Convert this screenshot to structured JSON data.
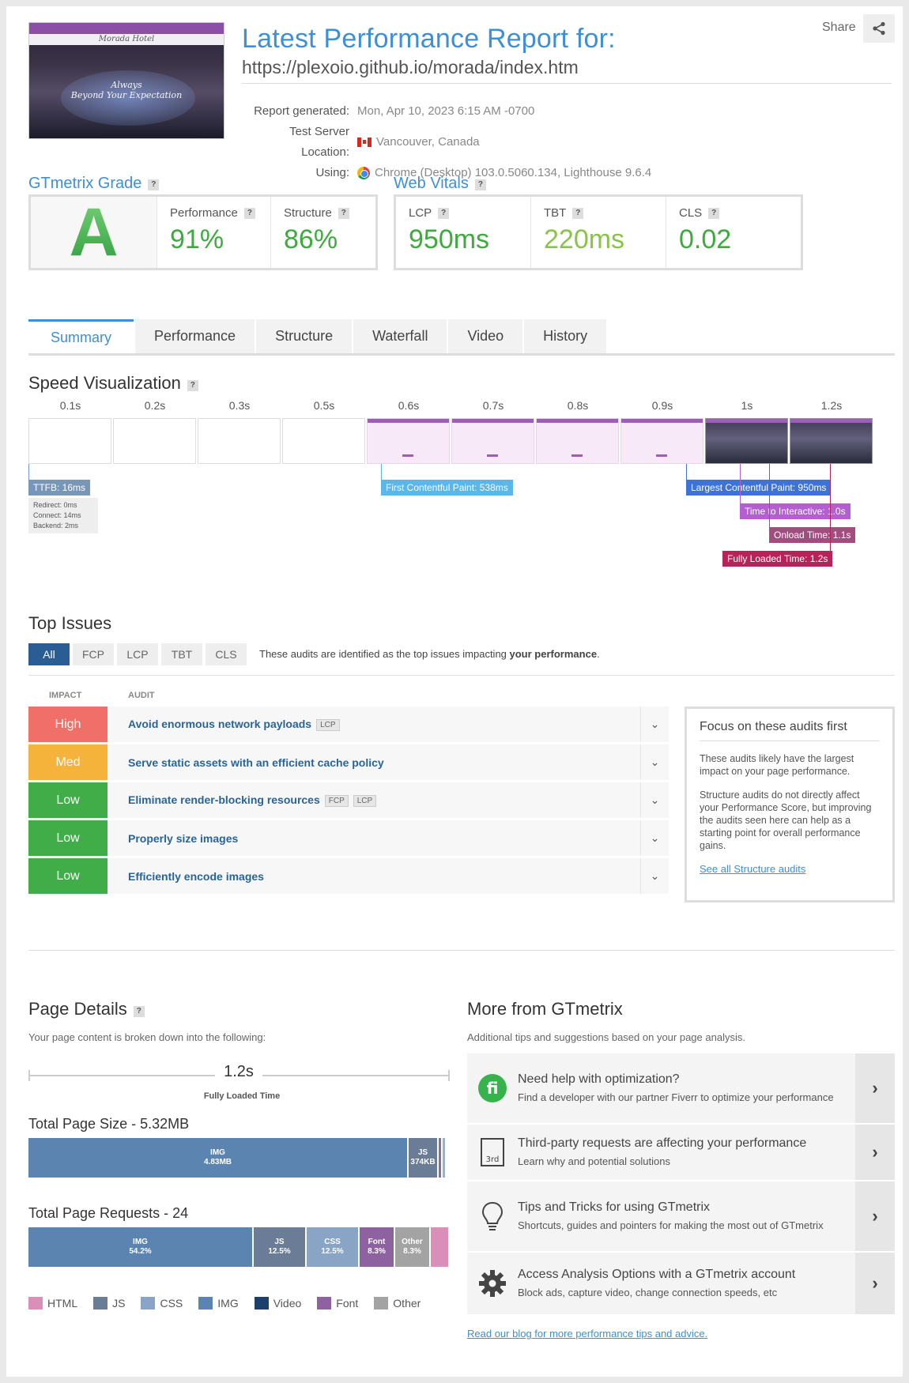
{
  "header": {
    "title": "Latest Performance Report for:",
    "url": "https://plexoio.github.io/morada/index.htm",
    "share_label": "Share",
    "thumbnail": {
      "brand": "Morada Hotel",
      "tagline_1": "Always",
      "tagline_2": "Beyond Your Expectation"
    },
    "meta": [
      {
        "key": "Report generated:",
        "value": "Mon, Apr 10, 2023 6:15 AM -0700"
      },
      {
        "key": "Test Server Location:",
        "value": "Vancouver, Canada",
        "icon": "canada-flag-icon"
      },
      {
        "key": "Using:",
        "value": "Chrome (Desktop) 103.0.5060.134, Lighthouse 9.6.4",
        "icon": "chrome-icon"
      }
    ]
  },
  "grade": {
    "title": "GTmetrix Grade",
    "help": "?",
    "letter": "A",
    "performance_label": "Performance",
    "performance_value": "91%",
    "structure_label": "Structure",
    "structure_value": "86%"
  },
  "vitals": {
    "title": "Web Vitals",
    "help": "?",
    "lcp_label": "LCP",
    "lcp_value": "950ms",
    "tbt_label": "TBT",
    "tbt_value": "220ms",
    "cls_label": "CLS",
    "cls_value": "0.02"
  },
  "tabs": [
    "Summary",
    "Performance",
    "Structure",
    "Waterfall",
    "Video",
    "History"
  ],
  "speed": {
    "title": "Speed Visualization",
    "ticks": [
      "0.1s",
      "0.2s",
      "0.3s",
      "0.5s",
      "0.6s",
      "0.7s",
      "0.8s",
      "0.9s",
      "1s",
      "1.2s"
    ],
    "ttfb": "TTFB: 16ms",
    "ttfb_details": [
      "Redirect: 0ms",
      "Connect: 14ms",
      "Backend: 2ms"
    ],
    "fcp": "First Contentful Paint: 538ms",
    "lcp": "Largest Contentful Paint: 950ms",
    "tti": "Time to Interactive: 1.0s",
    "onload": "Onload Time: 1.1s",
    "fully": "Fully Loaded Time: 1.2s"
  },
  "issues": {
    "title": "Top Issues",
    "filters": [
      "All",
      "FCP",
      "LCP",
      "TBT",
      "CLS"
    ],
    "note_prefix": "These audits are identified as the top issues impacting ",
    "note_bold": "your performance",
    "note_suffix": ".",
    "col_impact": "IMPACT",
    "col_audit": "AUDIT",
    "rows": [
      {
        "impact": "High",
        "title": "Avoid enormous network payloads",
        "badges": [
          "LCP"
        ]
      },
      {
        "impact": "Med",
        "title": "Serve static assets with an efficient cache policy",
        "badges": []
      },
      {
        "impact": "Low",
        "title": "Eliminate render-blocking resources",
        "badges": [
          "FCP",
          "LCP"
        ]
      },
      {
        "impact": "Low",
        "title": "Properly size images",
        "badges": []
      },
      {
        "impact": "Low",
        "title": "Efficiently encode images",
        "badges": []
      }
    ],
    "focus": {
      "title": "Focus on these audits first",
      "p1": "These audits likely have the largest impact on your page performance.",
      "p2": "Structure audits do not directly affect your Performance Score, but improving the audits seen here can help as a starting point for overall performance gains.",
      "link": "See all Structure audits"
    }
  },
  "details": {
    "title": "Page Details",
    "help": "?",
    "subtitle": "Your page content is broken down into the following:",
    "fully_loaded": "1.2s",
    "fully_loaded_label": "Fully Loaded Time",
    "size_title": "Total Page Size - 5.32MB",
    "requests_title": "Total Page Requests - 24",
    "size_segments": [
      {
        "name": "IMG",
        "value": "4.83MB",
        "share": 0.908,
        "color": "#5b84b1"
      },
      {
        "name": "JS",
        "value": "374KB",
        "share": 0.069,
        "color": "#6b7d96"
      },
      {
        "name": "",
        "value": "",
        "share": 0.006,
        "color": "#8e6aa3"
      },
      {
        "name": "",
        "value": "",
        "share": 0.006,
        "color": "#9cb0c8"
      }
    ],
    "request_segments": [
      {
        "name": "IMG",
        "value": "54.2%",
        "share": 0.542,
        "color": "#5b84b1"
      },
      {
        "name": "JS",
        "value": "12.5%",
        "share": 0.125,
        "color": "#6b7d96"
      },
      {
        "name": "CSS",
        "value": "12.5%",
        "share": 0.125,
        "color": "#8aa4c6"
      },
      {
        "name": "Font",
        "value": "8.3%",
        "share": 0.083,
        "color": "#8e62a0"
      },
      {
        "name": "Other",
        "value": "8.3%",
        "share": 0.083,
        "color": "#a3a3a3"
      },
      {
        "name": "",
        "value": "",
        "share": 0.042,
        "color": "#d98fb8"
      }
    ],
    "legend": [
      {
        "name": "HTML",
        "color": "#d98fb8"
      },
      {
        "name": "JS",
        "color": "#6b7d96"
      },
      {
        "name": "CSS",
        "color": "#8aa4c6"
      },
      {
        "name": "IMG",
        "color": "#5b84b1"
      },
      {
        "name": "Video",
        "color": "#1d3f6b"
      },
      {
        "name": "Font",
        "color": "#8e62a0"
      },
      {
        "name": "Other",
        "color": "#a3a3a3"
      }
    ]
  },
  "more": {
    "title": "More from GTmetrix",
    "subtitle": "Additional tips and suggestions based on your page analysis.",
    "items": [
      {
        "icon": "fiverr-icon",
        "t1": "Need help with optimization?",
        "t2": "Find a developer with our partner Fiverr to optimize your performance"
      },
      {
        "icon": "third-party-icon",
        "t1": "Third-party requests are affecting your performance",
        "t2": "Learn why and potential solutions",
        "icon_text": "3rd"
      },
      {
        "icon": "lightbulb-icon",
        "t1": "Tips and Tricks for using GTmetrix",
        "t2": "Shortcuts, guides and pointers for making the most out of GTmetrix"
      },
      {
        "icon": "gear-icon",
        "t1": "Access Analysis Options with a GTmetrix account",
        "t2": "Block ads, capture video, change connection speeds, etc"
      }
    ],
    "blog_link": "Read our blog for more performance tips and advice."
  }
}
